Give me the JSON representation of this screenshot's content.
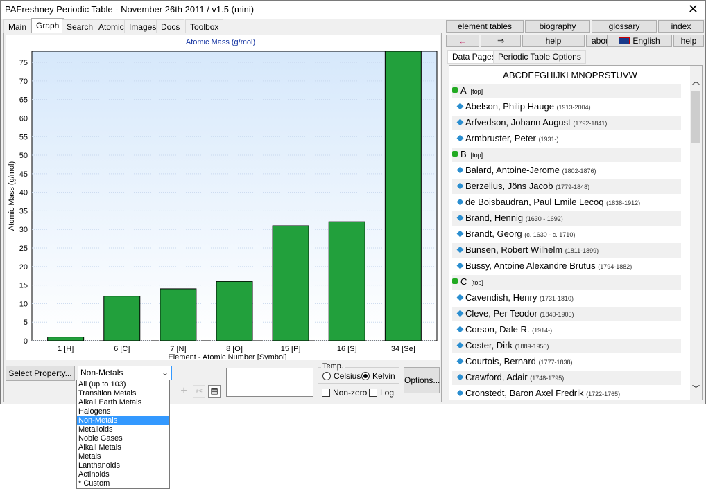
{
  "window": {
    "title": "PAFreshney Periodic Table - November 26th 2011 / v1.5 (mini)",
    "close": "✕"
  },
  "tabs": [
    "Main",
    "Graph",
    "Search",
    "Atomic",
    "Images",
    "Docs",
    "Toolbox"
  ],
  "active_tab": "Graph",
  "chart_data": {
    "type": "bar",
    "title": "Atomic Mass (g/mol)",
    "ylabel": "Atomic Mass (g/mol)",
    "xlabel": "Element - Atomic Number [Symbol]",
    "categories": [
      "1 [H]",
      "6 [C]",
      "7 [N]",
      "8 [O]",
      "15 [P]",
      "16 [S]",
      "34 [Se]"
    ],
    "values": [
      1.008,
      12.011,
      14.007,
      15.999,
      30.974,
      32.06,
      78.96
    ],
    "ylim": [
      0,
      78
    ],
    "yticks": [
      0,
      5,
      10,
      15,
      20,
      25,
      30,
      35,
      40,
      45,
      50,
      55,
      60,
      65,
      70,
      75
    ],
    "bar_color": "#22a03c",
    "grid": true
  },
  "controls": {
    "select_property": "Select Property...",
    "group_select": "Non-Metals",
    "temp_label": "Temp.",
    "celsius": "Celsius",
    "kelvin": "Kelvin",
    "nonzero": "Non-zero",
    "log": "Log",
    "options": "Options..."
  },
  "dropdown_options": [
    "All (up to 103)",
    "Transition Metals",
    "Alkali Earth Metals",
    "Halogens",
    "Non-Metals",
    "Metalloids",
    "Noble Gases",
    "Alkali Metals",
    "Metals",
    "Lanthanoids",
    "Actinoids",
    "* Custom"
  ],
  "right": {
    "buttons_row1": [
      "element tables",
      "biography",
      "glossary",
      "index"
    ],
    "buttons_row2": [
      "←",
      "⇒",
      "help",
      "about",
      "English",
      "help"
    ],
    "subtabs": [
      "Data Pages",
      "Periodic Table Options"
    ],
    "alphabet": "ABCDEFGHIJKLMNOPRSTUVW",
    "top_label": "[top]"
  },
  "entries": [
    {
      "kind": "header",
      "text": "A"
    },
    {
      "kind": "person",
      "name": "Abelson, Philip Hauge",
      "years": "(1913-2004)"
    },
    {
      "kind": "person",
      "name": "Arfvedson, Johann August",
      "years": "(1792-1841)"
    },
    {
      "kind": "person",
      "name": "Armbruster, Peter",
      "years": "(1931-)"
    },
    {
      "kind": "header",
      "text": "B"
    },
    {
      "kind": "person",
      "name": "Balard, Antoine-Jerome",
      "years": "(1802-1876)"
    },
    {
      "kind": "person",
      "name": "Berzelius, Jöns Jacob",
      "years": "(1779-1848)"
    },
    {
      "kind": "person",
      "name": "de Boisbaudran, Paul Emile Lecoq",
      "years": "(1838-1912)"
    },
    {
      "kind": "person",
      "name": "Brand, Hennig",
      "years": "(1630 - 1692)"
    },
    {
      "kind": "person",
      "name": "Brandt, Georg",
      "years": "(c. 1630 - c. 1710)"
    },
    {
      "kind": "person",
      "name": "Bunsen, Robert Wilhelm",
      "years": "(1811-1899)"
    },
    {
      "kind": "person",
      "name": "Bussy, Antoine Alexandre Brutus",
      "years": "(1794-1882)"
    },
    {
      "kind": "header",
      "text": "C"
    },
    {
      "kind": "person",
      "name": "Cavendish, Henry",
      "years": "(1731-1810)"
    },
    {
      "kind": "person",
      "name": "Cleve, Per Teodor",
      "years": "(1840-1905)"
    },
    {
      "kind": "person",
      "name": "Corson, Dale R.",
      "years": "(1914-)"
    },
    {
      "kind": "person",
      "name": "Coster, Dirk",
      "years": "(1889-1950)"
    },
    {
      "kind": "person",
      "name": "Courtois, Bernard",
      "years": "(1777-1838)"
    },
    {
      "kind": "person",
      "name": "Crawford, Adair",
      "years": "(1748-1795)"
    },
    {
      "kind": "person",
      "name": "Cronstedt, Baron Axel Fredrik",
      "years": "(1722-1765)"
    }
  ]
}
